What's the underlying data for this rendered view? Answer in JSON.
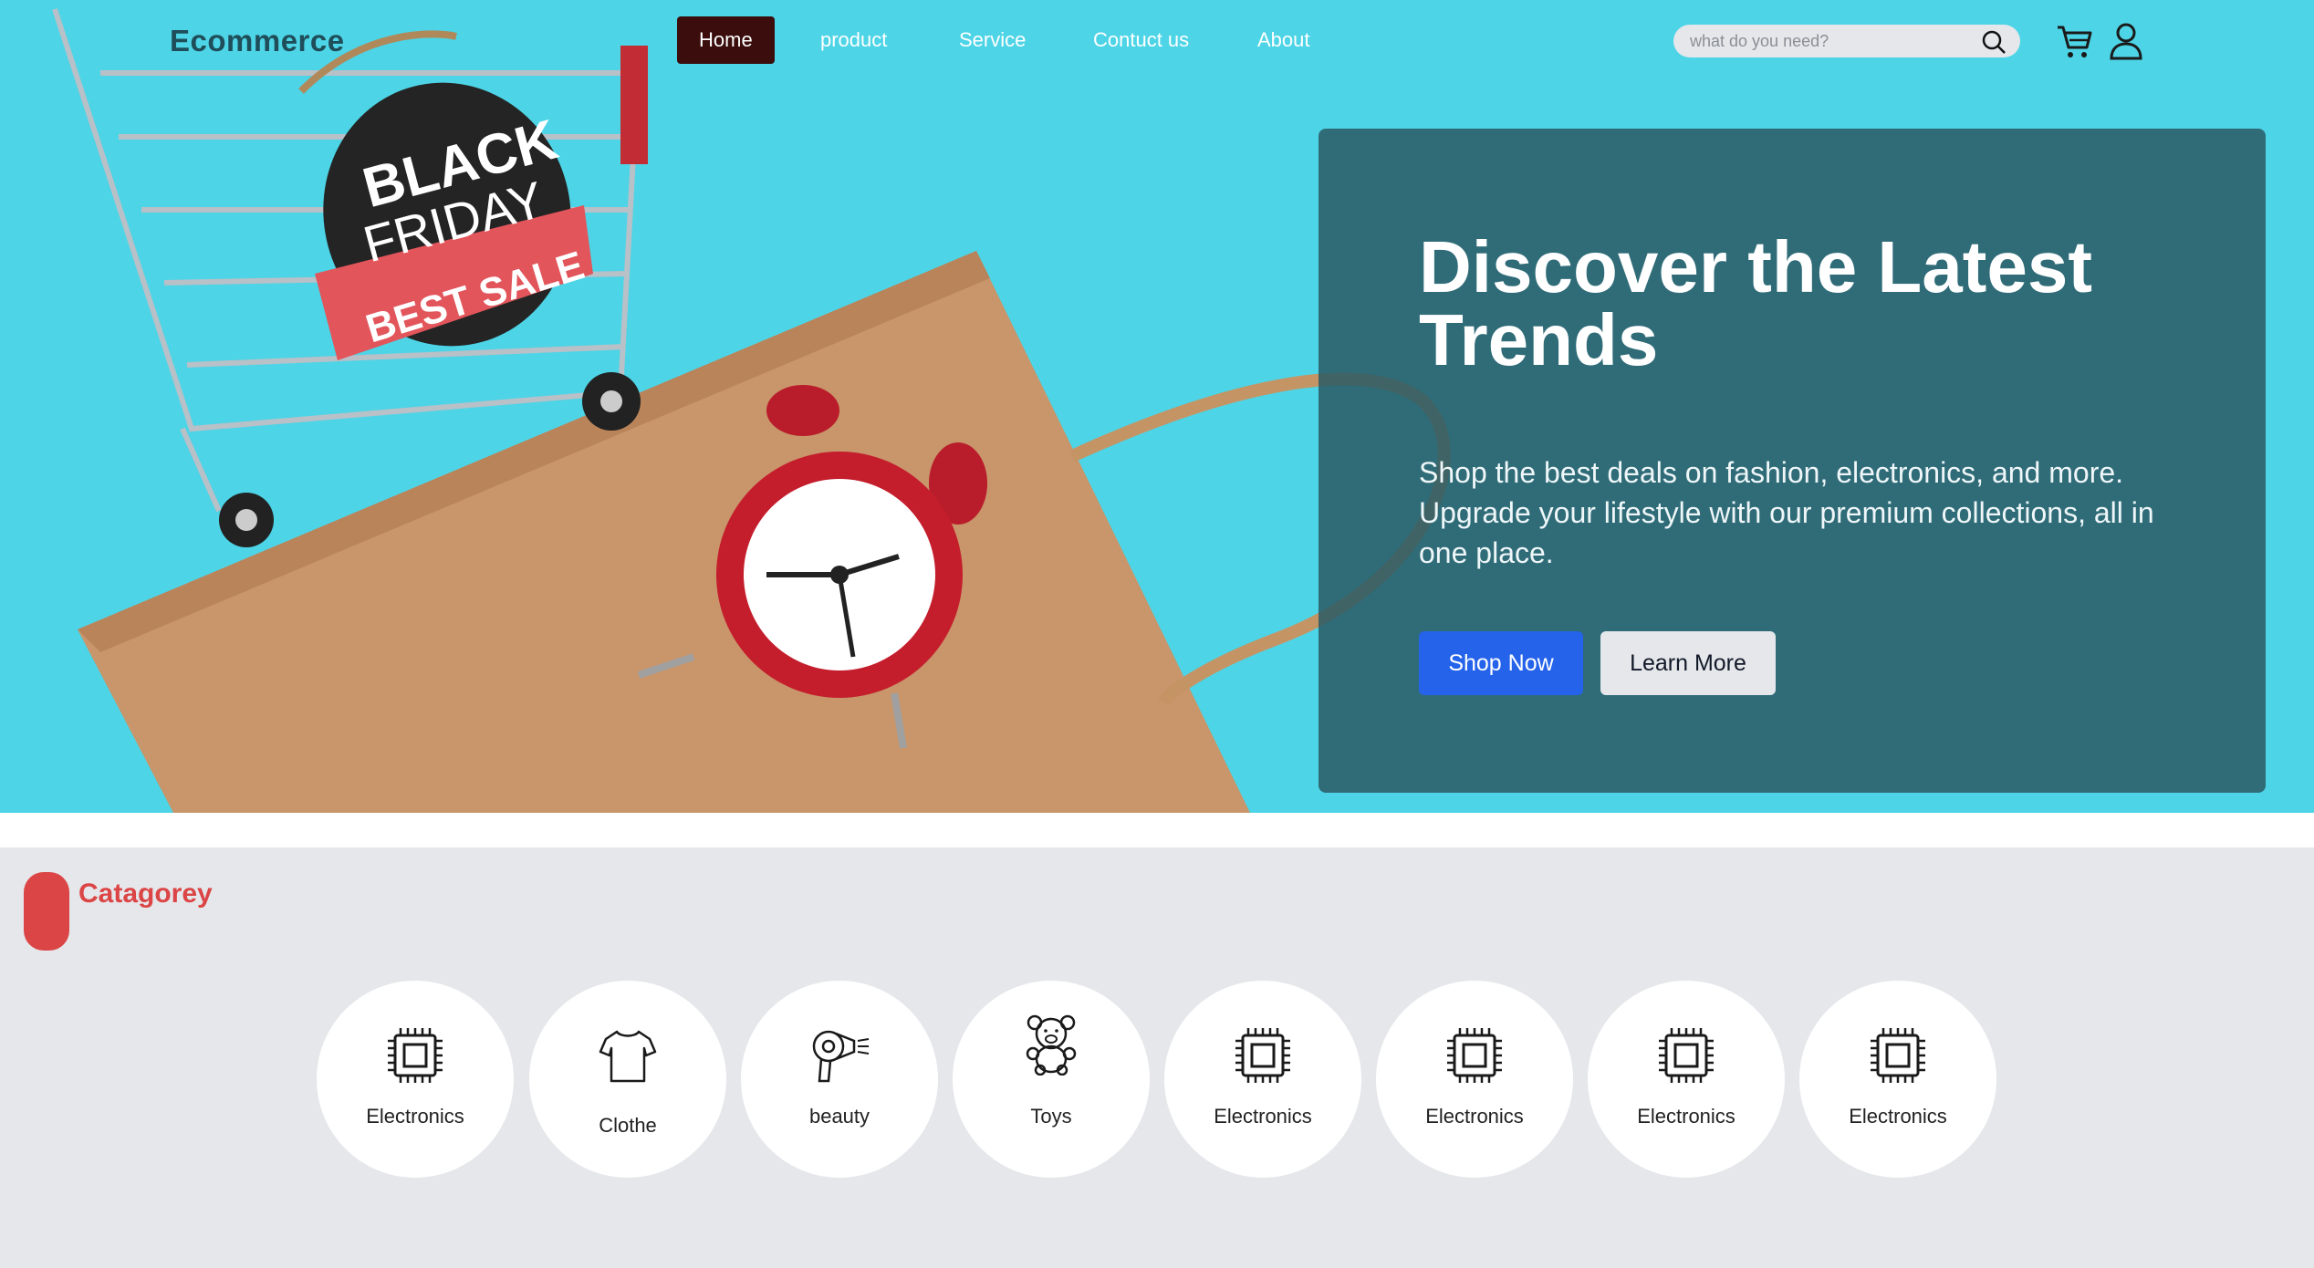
{
  "brand": "Ecommerce",
  "nav": {
    "items": [
      "Home",
      "product",
      "Service",
      "Contuct us",
      "About"
    ],
    "active": "Home"
  },
  "search": {
    "placeholder": "what do you need?"
  },
  "icons": {
    "search": "search-icon",
    "cart": "cart-icon",
    "user": "user-icon"
  },
  "hero": {
    "title": "Discover the Latest Trends",
    "subtitle": "Shop the best deals on fashion, electronics, and more. Upgrade your lifestyle with our premium collections, all in one place.",
    "primary_button": "Shop Now",
    "secondary_button": "Learn More",
    "tag_text": [
      "BLACK",
      "FRIDAY",
      "BEST SALE"
    ]
  },
  "categories": {
    "title": "Catagorey",
    "items": [
      {
        "label": "Electronics",
        "icon": "chip-icon"
      },
      {
        "label": "Clothe",
        "icon": "shirt-icon"
      },
      {
        "label": "beauty",
        "icon": "hair-dryer-icon"
      },
      {
        "label": "Toys",
        "icon": "teddy-bear-icon"
      },
      {
        "label": "Electronics",
        "icon": "chip-icon"
      },
      {
        "label": "Electronics",
        "icon": "chip-icon"
      },
      {
        "label": "Electronics",
        "icon": "chip-icon"
      },
      {
        "label": "Electronics",
        "icon": "chip-icon"
      }
    ]
  },
  "colors": {
    "hero_bg": "#4dd4e6",
    "panel": "#2a5b65",
    "primary": "#2563eb",
    "accent": "#dc4545",
    "nav_active": "#3b0d0d"
  }
}
